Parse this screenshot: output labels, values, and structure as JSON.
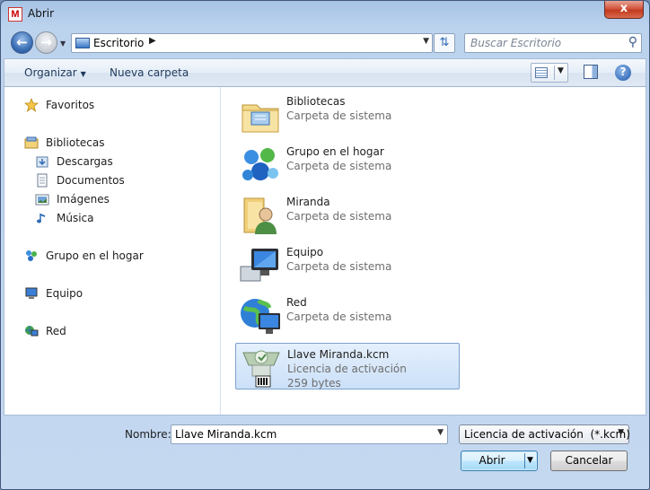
{
  "window": {
    "title": "Abrir",
    "app_icon_letter": "M",
    "close_symbol": "x"
  },
  "nav": {
    "address_location": "Escritorio",
    "search_placeholder": "Buscar Escritorio"
  },
  "toolbar": {
    "organize_label": "Organizar",
    "new_folder_label": "Nueva carpeta"
  },
  "sidebar": {
    "favorites": "Favoritos",
    "libraries": "Bibliotecas",
    "downloads": "Descargas",
    "documents": "Documentos",
    "images": "Imágenes",
    "music": "Música",
    "homegroup": "Grupo en el hogar",
    "computer": "Equipo",
    "network": "Red"
  },
  "files": [
    {
      "name": "Bibliotecas",
      "desc": "Carpeta de sistema",
      "icon": "libraries-folder-icon"
    },
    {
      "name": "Grupo en el hogar",
      "desc": "Carpeta de sistema",
      "icon": "homegroup-icon"
    },
    {
      "name": "Miranda",
      "desc": "Carpeta de sistema",
      "icon": "user-folder-icon"
    },
    {
      "name": "Equipo",
      "desc": "Carpeta de sistema",
      "icon": "computer-icon"
    },
    {
      "name": "Red",
      "desc": "Carpeta de sistema",
      "icon": "network-icon"
    },
    {
      "name": "Llave Miranda.kcm",
      "desc": "Licencia de activación",
      "size": "259 bytes",
      "icon": "key-file-icon",
      "selected": true
    }
  ],
  "footer": {
    "name_label": "Nombre:",
    "name_value": "Llave Miranda.kcm",
    "filetype_value": "Licencia de activación  (*.kcm)",
    "open_label": "Abrir",
    "cancel_label": "Cancelar"
  },
  "colors": {
    "selection": "#cbe0f8",
    "accent": "#3c7fb1"
  }
}
